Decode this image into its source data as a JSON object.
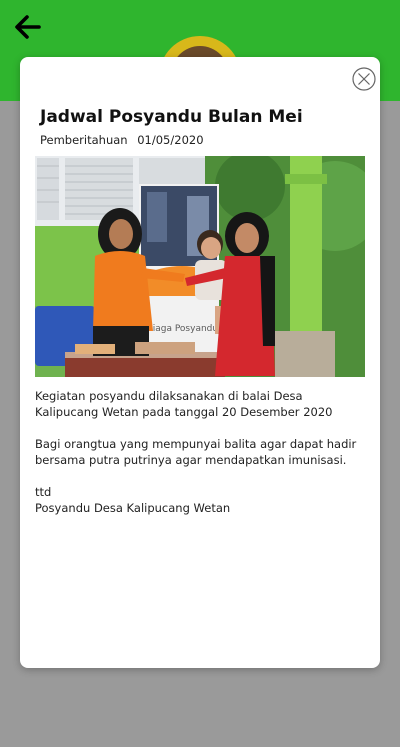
{
  "header": {
    "background_color": "#2fb52e",
    "back_icon": "arrow-left-icon"
  },
  "modal": {
    "title": "Jadwal Posyandu Bulan Mei",
    "category": "Pemberitahuan",
    "date": "01/05/2020",
    "close_icon": "close-circle-icon",
    "photo": {
      "banner_text": "Siaga Posyandu"
    },
    "paragraphs": [
      "Kegiatan posyandu dilaksanakan di balai Desa Kalipucang Wetan pada tanggal 20 Desember 2020",
      "Bagi orangtua yang mempunyai balita agar dapat hadir bersama putra putrinya agar mendapatkan imunisasi."
    ],
    "signature": {
      "line1": "ttd",
      "line2": "Posyandu Desa Kalipucang Wetan"
    }
  }
}
